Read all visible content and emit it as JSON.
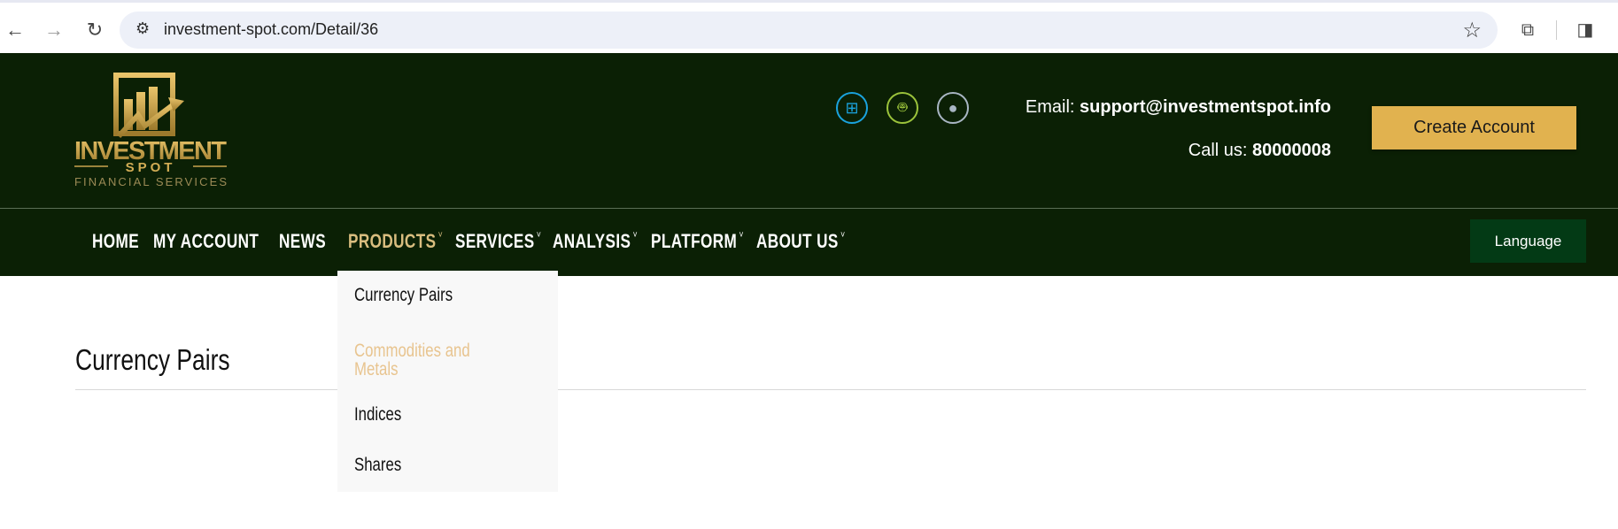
{
  "browser": {
    "url": "investment-spot.com/Detail/36",
    "icons": [
      "back-icon",
      "forward-icon",
      "reload-icon",
      "site-settings-icon",
      "bookmark-star-icon",
      "extensions-icon",
      "side-panel-icon"
    ]
  },
  "header": {
    "logo": {
      "line1": "INVESTMENT",
      "line2": "SPOT",
      "line3": "FINANCIAL SERVICES"
    },
    "platform_icons": [
      "windows-icon",
      "android-icon",
      "apple-icon"
    ],
    "email_label": "Email:",
    "email": "support@investmentspot.info",
    "call_label": "Call us:",
    "phone": "80000008",
    "create_account": "Create Account"
  },
  "nav": {
    "items": [
      {
        "label": "HOME",
        "dropdown": false
      },
      {
        "label": "MY ACCOUNT",
        "dropdown": false
      },
      {
        "label": "NEWS",
        "dropdown": false
      },
      {
        "label": "PRODUCTS",
        "dropdown": true,
        "active": true
      },
      {
        "label": "SERVICES",
        "dropdown": true
      },
      {
        "label": "ANALYSIS",
        "dropdown": true
      },
      {
        "label": "PLATFORM",
        "dropdown": true
      },
      {
        "label": "ABOUT US",
        "dropdown": true
      }
    ],
    "chevron": "˅",
    "language": "Language"
  },
  "products_menu": {
    "items": [
      "Currency Pairs",
      "Commodities and",
      "Metals",
      "Indices",
      "Shares"
    ],
    "hovered": "Commodities and Metals"
  },
  "main": {
    "title": "Currency Pairs"
  },
  "colors": {
    "header_bg": "#0b2005",
    "gold": "#e1b24f",
    "active_nav": "#d9bd7f",
    "language_bg": "#033a15",
    "hover_item": "#e8c48f"
  }
}
